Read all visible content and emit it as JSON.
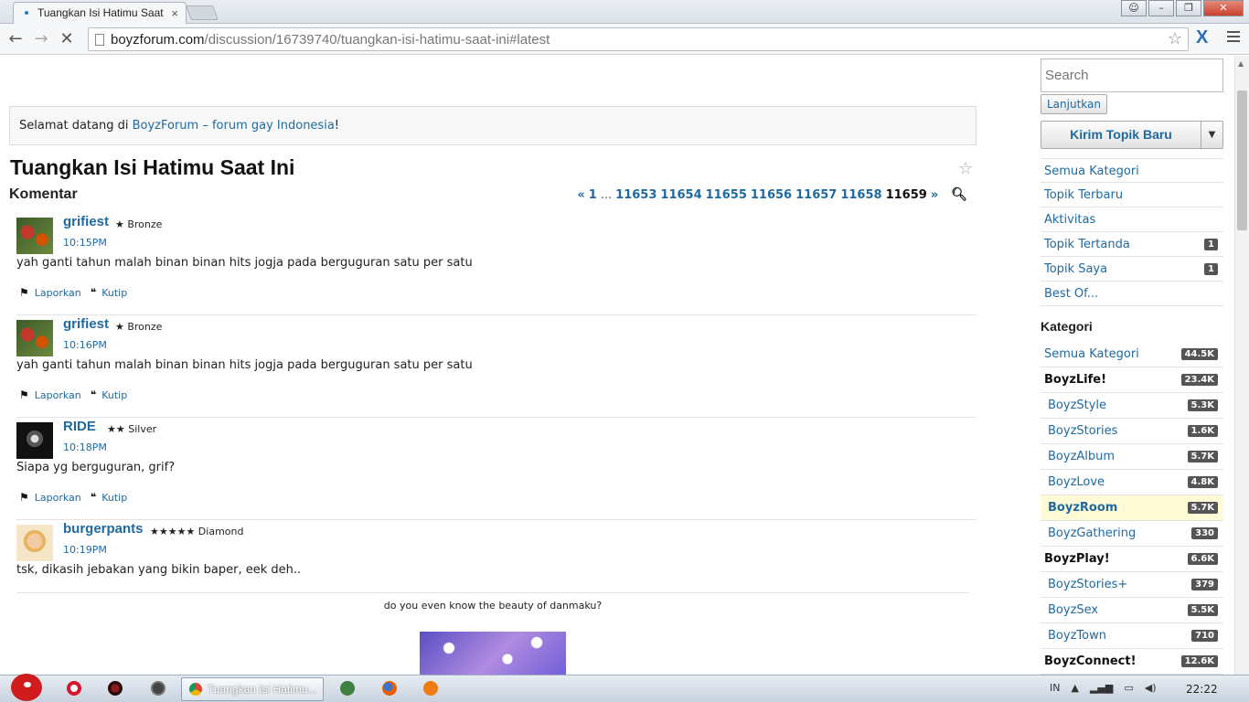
{
  "browser": {
    "tab_title": "Tuangkan Isi Hatimu Saat",
    "url_host": "boyzforum.com",
    "url_path": "/discussion/16739740/tuangkan-isi-hatimu-saat-ini#latest"
  },
  "welcome": {
    "prefix": "Selamat datang di ",
    "link": "BoyzForum – forum gay Indonesia",
    "suffix": "!"
  },
  "discussion": {
    "title": "Tuangkan Isi Hatimu Saat Ini",
    "section": "Komentar"
  },
  "pager": {
    "prev": "«",
    "first": "1",
    "ellipsis": "...",
    "pages": [
      "11653",
      "11654",
      "11655",
      "11656",
      "11657",
      "11658"
    ],
    "current": "11659",
    "next": "»"
  },
  "actions": {
    "report": "Laporkan",
    "quote": "Kutip"
  },
  "comments": [
    {
      "user": "grifiest",
      "rank": "★ Bronze",
      "time": "10:15PM",
      "body": "yah ganti tahun malah binan binan hits jogja pada berguguran satu per satu"
    },
    {
      "user": "grifiest",
      "rank": "★ Bronze",
      "time": "10:16PM",
      "body": "yah ganti tahun malah binan binan hits jogja pada berguguran satu per satu"
    },
    {
      "user": "RIDE",
      "rank": "★★ Silver",
      "time": "10:18PM",
      "body": "Siapa yg berguguran, grif?"
    },
    {
      "user": "burgerpants",
      "rank": "★★★★★ Diamond",
      "time": "10:19PM",
      "body": "tsk, dikasih jebakan yang bikin baper, eek deh..",
      "signature": "do you even know the beauty of danmaku?"
    }
  ],
  "sidebar": {
    "search_placeholder": "Search",
    "search_button": "Lanjutkan",
    "new_topic": "Kirim Topik Baru",
    "nav": [
      {
        "label": "Semua Kategori",
        "count": ""
      },
      {
        "label": "Topik Terbaru",
        "count": ""
      },
      {
        "label": "Aktivitas",
        "count": ""
      },
      {
        "label": "Topik Tertanda",
        "count": "1"
      },
      {
        "label": "Topik Saya",
        "count": "1"
      },
      {
        "label": "Best Of...",
        "count": ""
      }
    ],
    "categories_heading": "Kategori",
    "categories": [
      {
        "label": "Semua Kategori",
        "count": "44.5K"
      },
      {
        "label": "BoyzLife!",
        "count": "23.4K"
      },
      {
        "label": "BoyzStyle",
        "count": "5.3K"
      },
      {
        "label": "BoyzStories",
        "count": "1.6K"
      },
      {
        "label": "BoyzAlbum",
        "count": "5.7K"
      },
      {
        "label": "BoyzLove",
        "count": "4.8K"
      },
      {
        "label": "BoyzRoom",
        "count": "5.7K"
      },
      {
        "label": "BoyzGathering",
        "count": "330"
      },
      {
        "label": "BoyzPlay!",
        "count": "6.6K"
      },
      {
        "label": "BoyzStories+",
        "count": "379"
      },
      {
        "label": "BoyzSex",
        "count": "5.5K"
      },
      {
        "label": "BoyzTown",
        "count": "710"
      },
      {
        "label": "BoyzConnect!",
        "count": "12.6K"
      }
    ]
  },
  "taskbar": {
    "app_label": "Tuangkan Isi Hatimu...",
    "lang": "IN",
    "clock": "22:22"
  }
}
